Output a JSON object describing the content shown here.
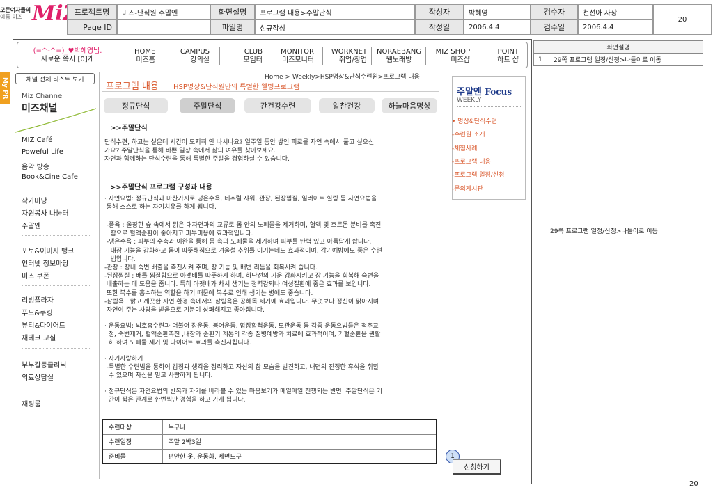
{
  "header": {
    "logo": {
      "line1": "모든여자들의",
      "line2": "이름 미즈",
      "mark": "MiZ"
    },
    "project_label": "프로젝트명",
    "project_value": "미즈-단식원 주말엔",
    "screen_label": "화면설명",
    "screen_value": "프로그램 내용>주말단식",
    "author_label": "작성자",
    "author_value": "박혜영",
    "reviewer_label": "검수자",
    "reviewer_value": "천선아 사장",
    "page_no": "20",
    "pageid_label": "Page ID",
    "file_label": "파일명",
    "file_value": "신규작성",
    "date_label": "작성일",
    "date_value": "2006.4.4",
    "review_date_label": "검수일",
    "review_date_value": "2006.4.4"
  },
  "user": {
    "greeting": "(=^-^=)_♥박혜영님.",
    "note": "새로운 쪽지 [0]개"
  },
  "nav": [
    {
      "en": "HOME",
      "ko": "미즈홈"
    },
    {
      "en": "CAMPUS",
      "ko": "강의실"
    },
    {
      "en": "CLUB",
      "ko": "모임터"
    },
    {
      "en": "MONITOR",
      "ko": "미즈모니터"
    },
    {
      "en": "WORKNET",
      "ko": "취업/창업"
    },
    {
      "en": "NORAEBANG",
      "ko": "웹노래방"
    },
    {
      "en": "MIZ SHOP",
      "ko": "미즈샵"
    },
    {
      "en": "POINT",
      "ko": "하트 샵"
    }
  ],
  "mypr": "My PR",
  "sidebar": {
    "list_button": "채널 전체 리스트 보기",
    "channel_en": "Miz Channel",
    "channel_ko": "미즈채널",
    "groups": [
      [
        "MIZ Café",
        "Poweful Life",
        "음악 방송",
        "Book&Cine Cafe"
      ],
      [
        "작가마당",
        "자원봉사 나눔터",
        "주말엔"
      ],
      [
        "포토&이미지 뱅크",
        "인터넷 정보마당",
        "미즈 쿠폰"
      ],
      [
        "리빙플라자",
        "푸드&쿠킹",
        "뷰티&다이어트",
        "재테크 교실"
      ],
      [
        "부부갈등클리닉",
        "의료상담실"
      ],
      [
        "재팅룸"
      ]
    ]
  },
  "content": {
    "breadcrumb": "Home > Weekly>HSP명상&단식수련원>프로그램 내용",
    "title_ko": "프로그램 내용",
    "title_sub": "HSP명상&단식원만의 특별한 웰빙프로그램",
    "tabs": [
      "정규단식",
      "주말단식",
      "간건강수련",
      "알찬건강",
      "하늘마음명상"
    ],
    "heading1": ">>주말단식",
    "para1": "단식수련, 하고는 싶은데 시간이 도저히 안 나시나요? 일주일 동안 쌓인 피로를 자연 속에서 풀고 싶으신\n가요? 주말단식을 통해 바쁜 일상 속에서 삶의 여유를 찾아보세요.\n자연과 함께하는 단식수련을 통해 특별한 주말을 경험하실 수 있습니다.",
    "heading2": ">>주말단식 프로그램 구성과 내용",
    "para2": "· 자연요법: 정규단식과 마찬가지로 냉온수욕, 네추럴 샤워, 관장, 된장찜질, 일러이트 힐링 등 자연요법을\n 통해 스스로 하는 자기치유를 하게 됩니다.",
    "para3": " -풍욕 : 울창한 숲 속에서 맑은 대자연과의 교류로 몸 안의 노폐물을 제거하며, 혈액 및 호르몬 분비를 촉진\n   함으로 혈액순환이 좋아지고 피부미용에 효과적입니다.\n -냉온수욕 : 피부의 수축과 이완을 통해 몸 속의 노폐물을 제거하며 피부를 탄력 있고 아름답게 합니다.\n   내장 기능을 강화하고 몸이 따뜻해짐으로 겨울철 추위를 이기는데도 효과적이며, 감기예방에도 좋은 수련\n   법입니다.\n-관장 : 장내 숙변 배출을 촉진시켜 주며, 장 기능 및 배변 리듬을 회복시켜 줍니다.\n-된장찜질 : 배를 찜질함으로 아랫배를 따뜻하게 하며, 하단전의 기운 강화시키고 장 기능을 회복해 숙변을\n 배출하는 데 도움을 줍니다. 특히 아랫배가 차서 생기는 정력감퇴나 여성질환에 좋은 효과를 보입니다.\n 또한 복수를 흡수하는 역할을 하기 때문에 복수로 인해 생기는 병에도 좋습니다.\n-삼림욕 : 맑고 깨끗한 자연 환경 속에서의 삼림욕은 공해독 제거에 효과입니다. 무엇보다 정신이 맑아지며\n 자연이 주는 사랑을 받음으로 기분이 상쾌해지고 좋아집니다.",
    "para4": "· 운동요법: 뇌호흡수련과 더불어 장운동, 붕어운동, 합장합척운동, 모관운동 등 각종 운동요법들은 척추교\n  정, 숙변제거, 혈액순환촉진 ,내장과 순환기 계통의 각종 질병예방과 치료에 효과적이며, 기혈순환을 원활\n  히 하여 노폐물 제거 및 다이어트 효과를 촉진시킵니다.",
    "para5": "· 자기사랑하기\n -특별한 수련법을 통하여 감정과 생각을 정리하고 자신의 참 모습을 발견하고, 내면의 진정한 휴식을 취할\n  수 있으며 자신을 믿고 사랑하게 됩니다.",
    "para6": "· 정규단식은 자연요법의 반복과 자기를 바라볼 수 있는 마음보기가 매일매일 진행되는 반면  주말단식은 기\n  간이 짧은 관계로 한번씩만 경험을 하고 가게 됩니다.",
    "table": [
      {
        "label": "수련대상",
        "value": "누구나"
      },
      {
        "label": "수련일정",
        "value": "주말 2박3일"
      },
      {
        "label": "준비물",
        "value": "편안한 옷, 운동화, 세면도구"
      }
    ]
  },
  "focus": {
    "title": "주말엔",
    "title_en": "Focus",
    "weekly": "WEEKLY",
    "links": [
      "• 명상&단식수련",
      "-수련원 소개",
      "-체험사례",
      "-프로그램 내용",
      "-프로그램 일정/신청",
      "-문의게시판"
    ]
  },
  "apply": {
    "marker": "1",
    "button": "신청하기"
  },
  "desc": {
    "header": "화면설명",
    "row_no": "1",
    "row_text": "29쪽 프로그램 일정/신청>나들이로 이동",
    "side_note": "29쪽 프로그램 일정/신청>나들이로 이동"
  },
  "footer_page": "20",
  "colors": {
    "accent": "#d9572b",
    "mypr": "#f0a020",
    "heart": "#e0206a"
  }
}
